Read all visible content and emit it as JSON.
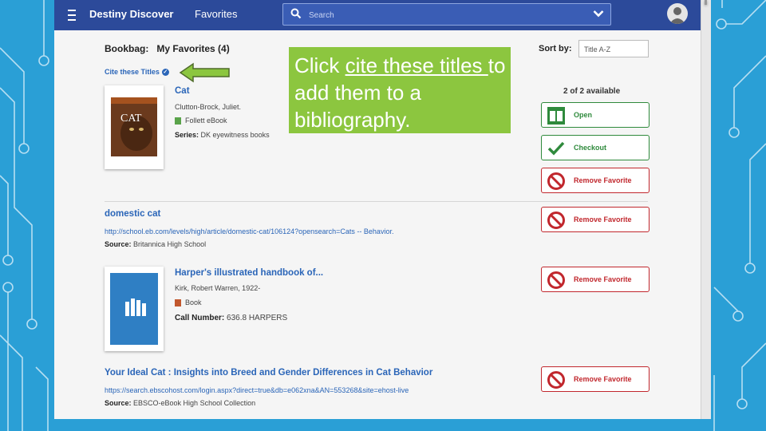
{
  "topbar": {
    "brand": "Destiny Discover",
    "favorites": "Favorites",
    "search_placeholder": "Search"
  },
  "bookbag": {
    "label": "Bookbag:",
    "title": "My Favorites (4)",
    "cite_label": "Cite these Titles",
    "sort_label": "Sort by:",
    "sort_value": "Title A-Z"
  },
  "callout": {
    "prefix": "Click ",
    "link_text": "cite these titles ",
    "suffix": "to add them to a bibliography."
  },
  "items": [
    {
      "title": "Cat",
      "author": "Clutton-Brock, Juliet.",
      "format": "Follett eBook",
      "series_label": "Series:",
      "series": "DK eyewitness books",
      "availability": "2 of 2 available",
      "actions": [
        "Open",
        "Checkout",
        "Remove Favorite"
      ],
      "cover_text": "CAT"
    },
    {
      "title": "domestic cat",
      "url": "http://school.eb.com/levels/high/article/domestic-cat/106124?opensearch=Cats -- Behavior.",
      "source_label": "Source:",
      "source": "Britannica High School",
      "actions": [
        "Remove Favorite"
      ]
    },
    {
      "title": "Harper's illustrated handbook of...",
      "author": "Kirk, Robert Warren, 1922-",
      "format": "Book",
      "callnum_label": "Call Number:",
      "callnum": "636.8 HARPERS",
      "actions": [
        "Remove Favorite"
      ]
    },
    {
      "title": "Your Ideal Cat : Insights into Breed and Gender Differences in Cat Behavior",
      "url": "https://search.ebscohost.com/login.aspx?direct=true&db=e062xna&AN=553268&site=ehost-live",
      "source_label": "Source:",
      "source": "EBSCO-eBook High School Collection",
      "actions": [
        "Remove Favorite"
      ]
    }
  ],
  "colors": {
    "topbar": "#2c4a9a",
    "link": "#2a65b8",
    "green": "#2f8a3c",
    "red": "#c1272d",
    "callout": "#8cc63f",
    "slide_bg": "#2a9fd6"
  }
}
